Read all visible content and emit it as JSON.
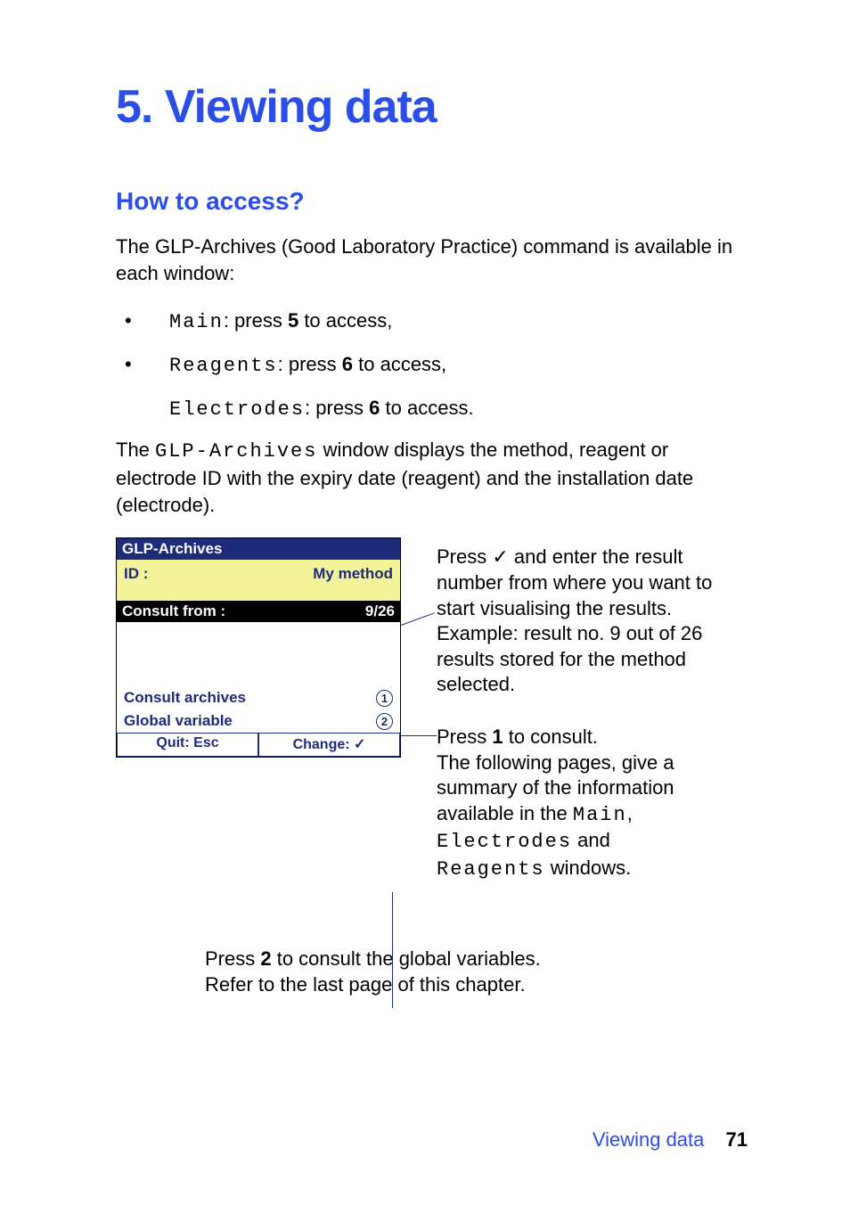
{
  "chapter": {
    "title": "5. Viewing data"
  },
  "section": {
    "title": "How to access?"
  },
  "intro": "The GLP-Archives (Good Laboratory Practice) command is available in each window:",
  "bullets": [
    {
      "label": "Main",
      "rest": ": press ",
      "key": "5",
      "tail": " to access,"
    },
    {
      "label": "Reagents",
      "rest": ": press ",
      "key": "6",
      "tail": " to access,"
    }
  ],
  "extra_line": {
    "label": "Electrodes",
    "rest": ": press ",
    "key": "6",
    "tail": " to access."
  },
  "para2a": "The ",
  "para2_mono": "GLP-Archives",
  "para2b": " window displays the method, reagent or electrode ID with the expiry date (reagent) and the installation date (electrode).",
  "lcd": {
    "title": "GLP-Archives",
    "id_label": "ID :",
    "id_value": "My method",
    "consult_from_label": "Consult from :",
    "consult_from_value": "9/26",
    "opt1_label": "Consult archives",
    "opt1_num": "1",
    "opt2_label": "Global variable",
    "opt2_num": "2",
    "footer_left": "Quit: Esc",
    "footer_right": "Change: ✓"
  },
  "ann1": "Press ✓ and enter the result number from where you want to start visualising the results. Example: result no. 9 out of 26 results stored for the method selected.",
  "ann2a": "Press ",
  "ann2key": "1",
  "ann2b": " to consult.",
  "ann2c": "The following pages, give a summary of the information available in the ",
  "ann2m1": "Main",
  "ann2d": ",\n",
  "ann2m2": "Electrodes",
  "ann2e": " and ",
  "ann2m3": "Reagents",
  "ann2f": " windows.",
  "center1a": "Press ",
  "center1key": "2",
  "center1b": " to consult the global variables.",
  "center2": "Refer to the last page of this chapter.",
  "footer": {
    "label": "Viewing data",
    "page": "71"
  }
}
